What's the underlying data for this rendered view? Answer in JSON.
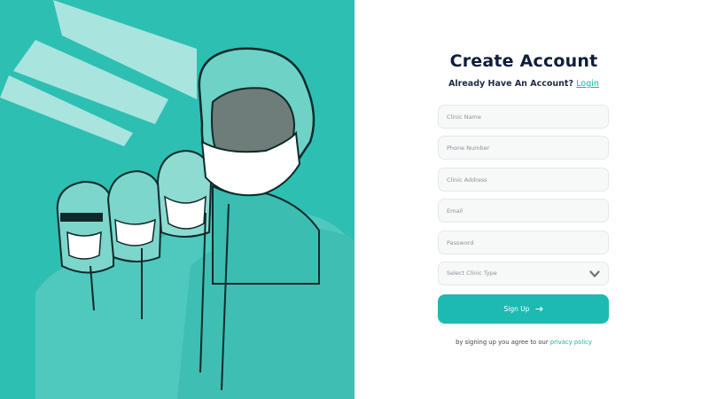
{
  "illustration": {
    "name": "medical-staff-illustration",
    "background_color": "#2ebfb3"
  },
  "form": {
    "title": "Create Account",
    "subtitle_prefix": "Already Have An Account?",
    "login_link": "Login",
    "fields": {
      "clinic_name": "Clinic Name",
      "phone_number": "Phone Number",
      "clinic_address": "Clinic Address",
      "email": "Email",
      "password": "Password"
    },
    "clinic_type_placeholder": "Select Clinic Type",
    "signup_label": "Sign Up",
    "terms_prefix": "by signing up you agree to our",
    "privacy_link": "privacy policy"
  },
  "colors": {
    "accent": "#1dbab2",
    "title": "#0f1d3a",
    "field_background": "#f7f8f8"
  },
  "icons": {
    "select": "chevron-down-icon",
    "button": "arrow-right-icon"
  }
}
